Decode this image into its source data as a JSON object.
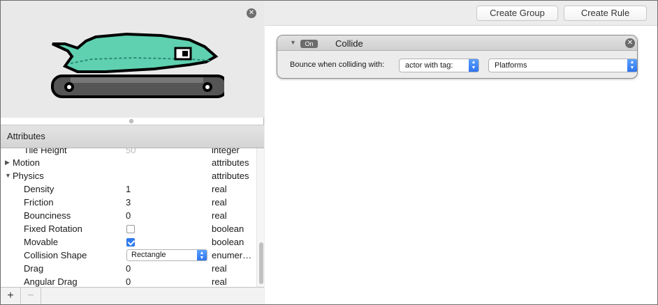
{
  "preview": {
    "close_icon": "close-icon",
    "sprite": "dolphin-on-tank-tread-sprite"
  },
  "attributes": {
    "header": "Attributes",
    "rows": [
      {
        "name": "Tile Height",
        "value": "50",
        "type": "integer"
      },
      {
        "name": "Motion",
        "value": "",
        "type": "attributes"
      },
      {
        "name": "Physics",
        "value": "",
        "type": "attributes"
      },
      {
        "name": "Density",
        "value": "1",
        "type": "real"
      },
      {
        "name": "Friction",
        "value": "3",
        "type": "real"
      },
      {
        "name": "Bounciness",
        "value": "0",
        "type": "real"
      },
      {
        "name": "Fixed Rotation",
        "value": "",
        "type": "boolean",
        "checked": false
      },
      {
        "name": "Movable",
        "value": "",
        "type": "boolean",
        "checked": true
      },
      {
        "name": "Collision Shape",
        "value": "Rectangle",
        "type": "enumer…"
      },
      {
        "name": "Drag",
        "value": "0",
        "type": "real"
      },
      {
        "name": "Angular Drag",
        "value": "0",
        "type": "real"
      }
    ]
  },
  "bottom_bar": {
    "add_label": "+",
    "remove_label": "−"
  },
  "toolbar": {
    "create_group": "Create Group",
    "create_rule": "Create Rule"
  },
  "rule": {
    "on_label": "On",
    "title": "Collide",
    "label": "Bounce when colliding with:",
    "target_select": "actor with tag:",
    "tag_select": "Platforms"
  },
  "colors": {
    "accent": "#2f7cf6",
    "sprite_body": "#5fd1b0"
  }
}
